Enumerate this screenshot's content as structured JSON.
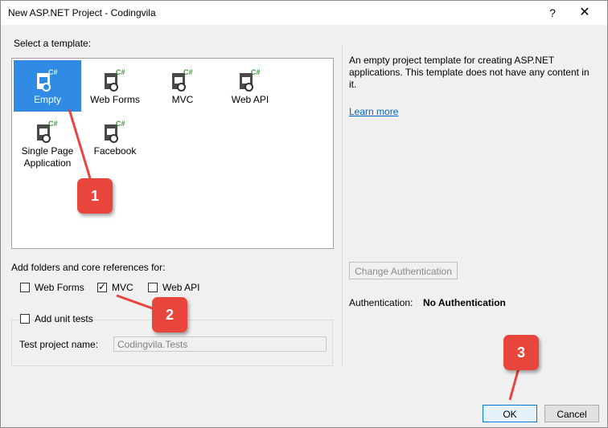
{
  "window": {
    "title": "New ASP.NET Project - Codingvila",
    "help": "?",
    "close": "✕"
  },
  "templates": {
    "section_label": "Select a template:",
    "items": [
      {
        "label": "Empty",
        "selected": true
      },
      {
        "label": "Web Forms"
      },
      {
        "label": "MVC"
      },
      {
        "label": "Web API"
      },
      {
        "label": "Single Page Application"
      },
      {
        "label": "Facebook"
      }
    ],
    "icon_badge": "C#"
  },
  "description": {
    "text": "An empty project template for creating ASP.NET applications. This template does not have any content in it.",
    "learn_more": "Learn more"
  },
  "references": {
    "label": "Add folders and core references for:",
    "options": [
      {
        "label": "Web Forms",
        "checked": false
      },
      {
        "label": "MVC",
        "checked": true
      },
      {
        "label": "Web API",
        "checked": false
      }
    ]
  },
  "unit_tests": {
    "label": "Add unit tests",
    "checked": false,
    "project_name_label": "Test project name:",
    "project_name_value": "Codingvila.Tests"
  },
  "auth": {
    "change_button": "Change Authentication",
    "label": "Authentication:",
    "value": "No Authentication"
  },
  "buttons": {
    "ok": "OK",
    "cancel": "Cancel"
  },
  "callouts": [
    "1",
    "2",
    "3"
  ],
  "colors": {
    "accent": "#2f8be3",
    "callout": "#e8453c",
    "link": "#0066cc"
  }
}
